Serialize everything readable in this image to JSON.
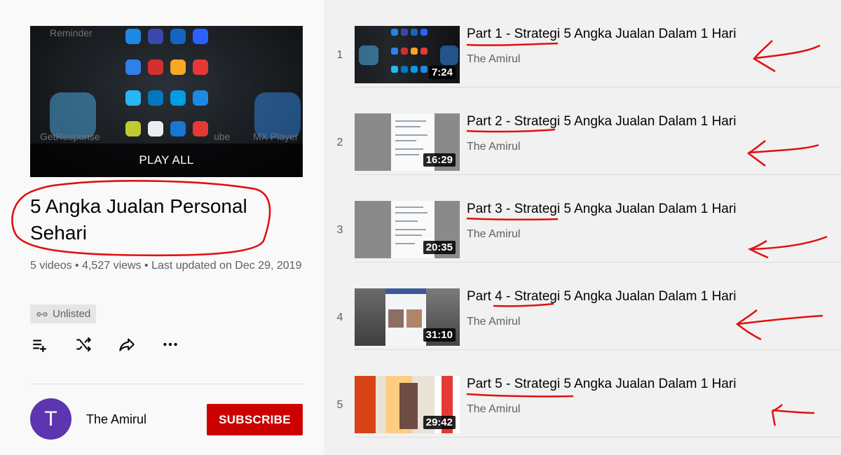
{
  "playlist": {
    "thumbnail_overlay": "PLAY ALL",
    "thumbnail_bg_labels": [
      "Reminder",
      "GetResponse",
      "MX Player",
      "ube"
    ],
    "title": "5 Angka Jualan Personal Sehari",
    "meta": "5 videos • 4,527 views • Last updated on Dec 29, 2019",
    "privacy_badge": "Unlisted",
    "actions": [
      "add-to-queue-icon",
      "shuffle-icon",
      "share-icon",
      "more-icon"
    ]
  },
  "owner": {
    "avatar_letter": "T",
    "channel_name": "The Amirul",
    "subscribe_label": "SUBSCRIBE",
    "avatar_color": "#5e35b1",
    "subscribe_color": "#cc0000"
  },
  "videos": [
    {
      "index": "1",
      "title": "Part 1 - Strategi 5 Angka Jualan Dalam 1 Hari",
      "channel": "The Amirul",
      "duration": "7:24"
    },
    {
      "index": "2",
      "title": "Part 2 - Strategi 5 Angka Jualan Dalam 1 Hari",
      "channel": "The Amirul",
      "duration": "16:29"
    },
    {
      "index": "3",
      "title": "Part 3 - Strategi 5 Angka Jualan Dalam 1 Hari",
      "channel": "The Amirul",
      "duration": "20:35"
    },
    {
      "index": "4",
      "title": "Part 4 - Strategi 5 Angka Jualan Dalam 1 Hari",
      "channel": "The Amirul",
      "duration": "31:10"
    },
    {
      "index": "5",
      "title": "Part 5 - Strategi 5 Angka Jualan Dalam 1 Hari",
      "channel": "The Amirul",
      "duration": "29:42"
    }
  ],
  "annotation_color": "#e01010"
}
